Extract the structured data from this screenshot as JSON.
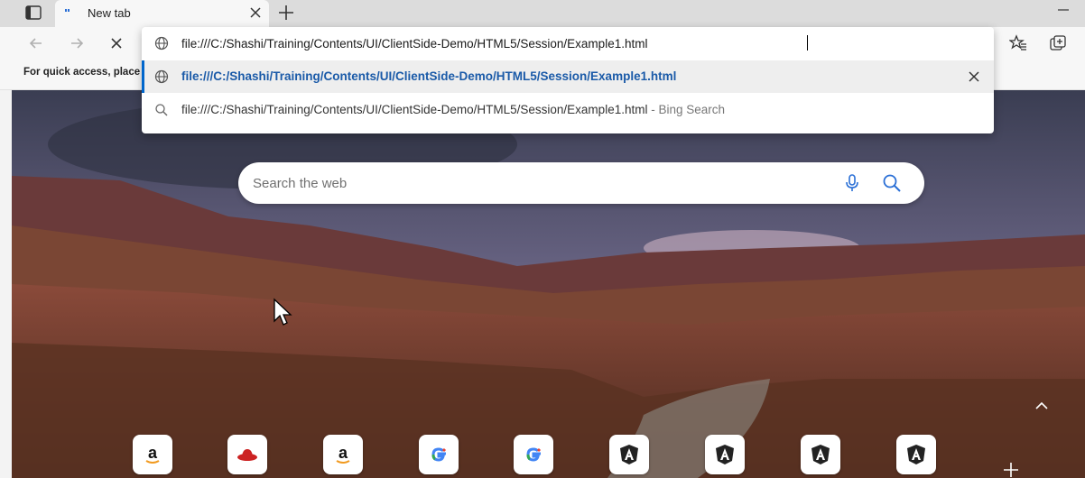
{
  "tab": {
    "title": "New tab"
  },
  "favorites_bar": {
    "hint": "For quick access, place your favorites here on the favorites bar."
  },
  "address_bar": {
    "value": "file:///C:/Shashi/Training/Contents/UI/ClientSide-Demo/HTML5/Session/Example1.html",
    "suggestions": [
      {
        "text": "file:///C:/Shashi/Training/Contents/UI/ClientSide-Demo/HTML5/Session/Example1.html",
        "icon": "globe-icon"
      },
      {
        "text": "file:///C:/Shashi/Training/Contents/UI/ClientSide-Demo/HTML5/Session/Example1.html",
        "suffix": "- Bing Search",
        "icon": "search-icon"
      }
    ]
  },
  "newtab_page": {
    "search_placeholder": "Search the web"
  },
  "colors": {
    "accent": "#0066cc",
    "link": "#1a5aa8"
  }
}
